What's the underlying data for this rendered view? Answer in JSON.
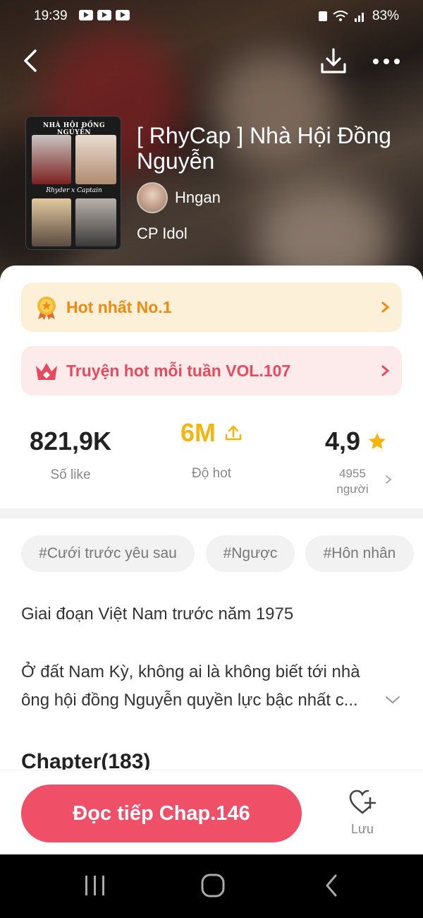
{
  "status_bar": {
    "time": "19:39",
    "battery": "83%"
  },
  "header": {
    "title": "[ RhyCap ] Nhà Hội Đồng Nguyễn",
    "author": "Hngan",
    "category": "CP Idol",
    "cover_title": "NHÀ HỘI ĐỒNG NGUYỄN",
    "cover_subtitle": "Rhyder x Captain"
  },
  "banners": [
    {
      "label": "Hot nhất No.1",
      "icon": "medal-icon",
      "color": "#ee8b0e"
    },
    {
      "label": "Truyện hot mỗi tuần VOL.107",
      "icon": "crown-icon",
      "color": "#e8495d"
    }
  ],
  "stats": {
    "likes": {
      "value": "821,9K",
      "label": "Số like"
    },
    "hot": {
      "value": "6M",
      "label": "Độ hot"
    },
    "rating": {
      "value": "4,9",
      "count": "4955",
      "unit": "người"
    }
  },
  "tags": [
    "#Cưới trước yêu sau",
    "#Ngược",
    "#Hôn nhân"
  ],
  "description": {
    "line1": "Giai đoạn Việt Nam trước năm 1975",
    "line2": "Ở đất Nam Kỳ, không ai là không biết tới nhà ông hội đồng Nguyễn quyền lực bậc nhất c..."
  },
  "chapters": {
    "title": "Chapter(183)"
  },
  "actions": {
    "read_label": "Đọc tiếp Chap.146",
    "save_label": "Lưu"
  },
  "colors": {
    "accent": "#f04f68",
    "hot": "#f6b40f",
    "star": "#f6b40f"
  }
}
